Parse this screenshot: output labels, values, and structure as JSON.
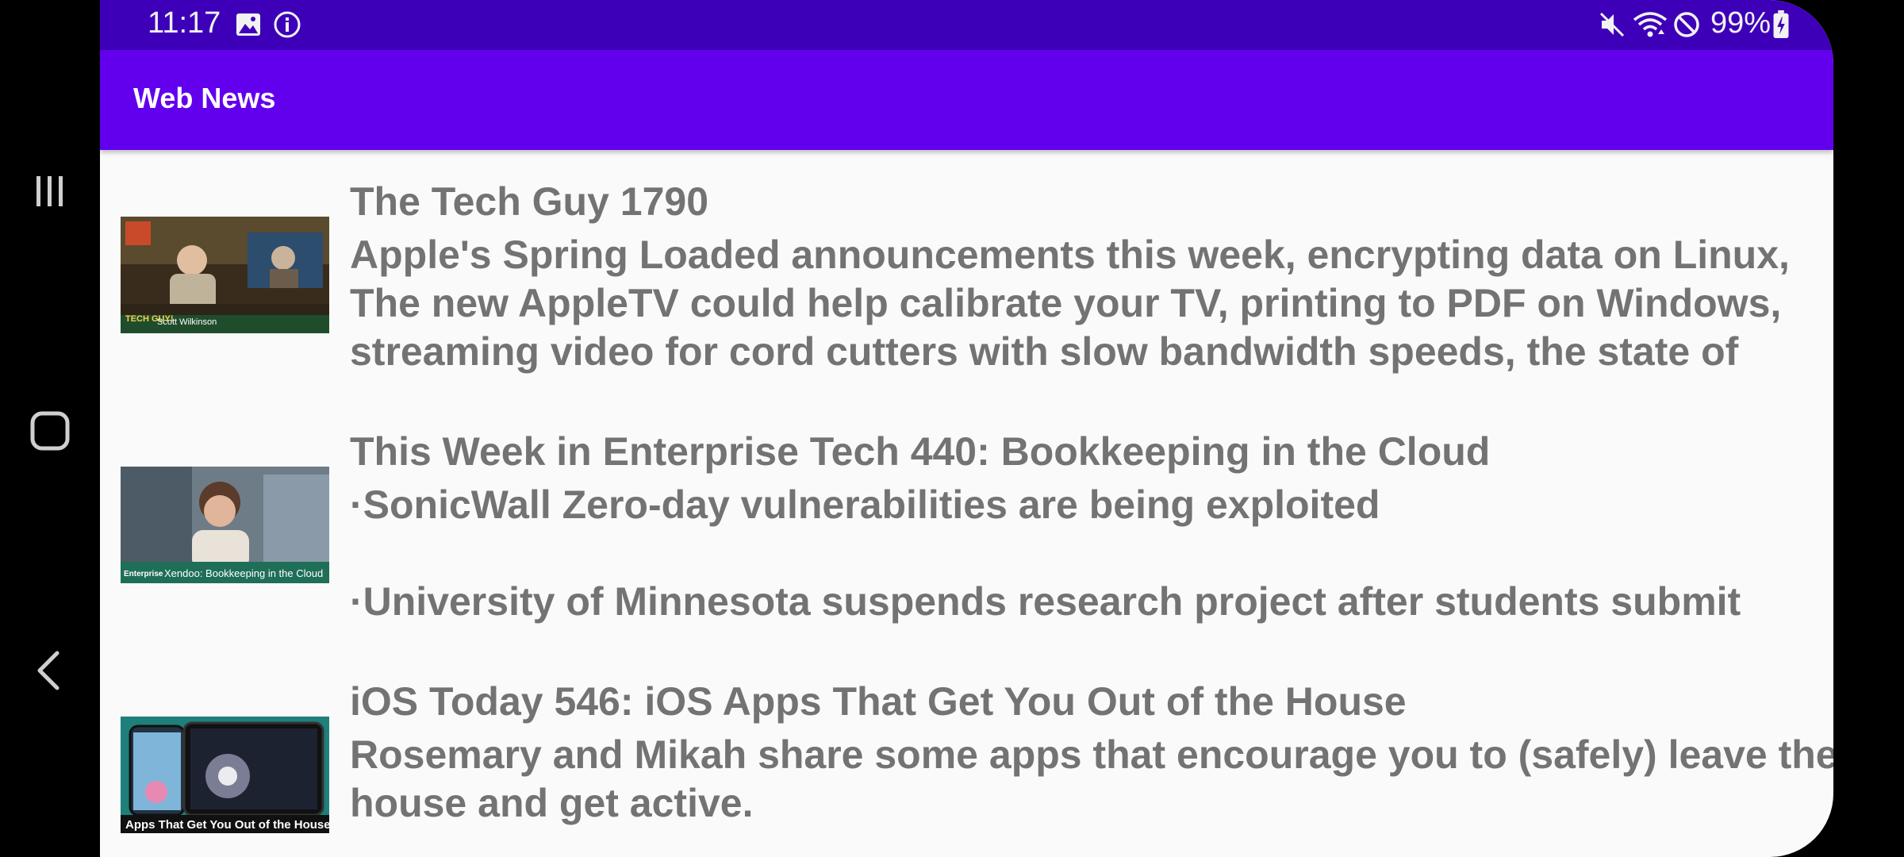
{
  "status_bar": {
    "time": "11:17",
    "battery": "99%",
    "icons": [
      "image-icon",
      "info-icon",
      "mute-icon",
      "wifi-icon",
      "no-disturb-icon",
      "battery-icon"
    ]
  },
  "app_bar": {
    "title": "Web News"
  },
  "nav": {
    "icons": [
      "recents-icon",
      "home-icon",
      "back-icon"
    ]
  },
  "articles": [
    {
      "title": "The Tech Guy 1790",
      "description_lines": [
        "Apple's Spring Loaded announcements this week, encrypting data on Linux,",
        "The new AppleTV could help calibrate your TV, printing to PDF on Windows,",
        "streaming video for cord cutters with slow bandwidth speeds, the state of"
      ],
      "thumb_caption": "Scott Wilkinson",
      "thumb_badge": "TECH GUY!"
    },
    {
      "title": "This Week in Enterprise Tech 440: Bookkeeping in the Cloud",
      "description_lines": [
        "·SonicWall Zero-day vulnerabilities are being exploited",
        "",
        "·University of Minnesota suspends research project after students submit"
      ],
      "thumb_caption": "Xendoo: Bookkeeping in the Cloud",
      "thumb_badge": "Enterprise"
    },
    {
      "title": "iOS Today 546: iOS Apps That Get You Out of the House",
      "description_lines": [
        "Rosemary and Mikah share some apps that encourage you to (safely) leave the",
        "house and get active."
      ],
      "thumb_caption": "Apps That Get You Out of the House",
      "thumb_badge": ""
    }
  ],
  "colors": {
    "status_bar": "#3d00b8",
    "app_bar": "#6200ee",
    "background": "#fafafa",
    "text": "#737373"
  }
}
